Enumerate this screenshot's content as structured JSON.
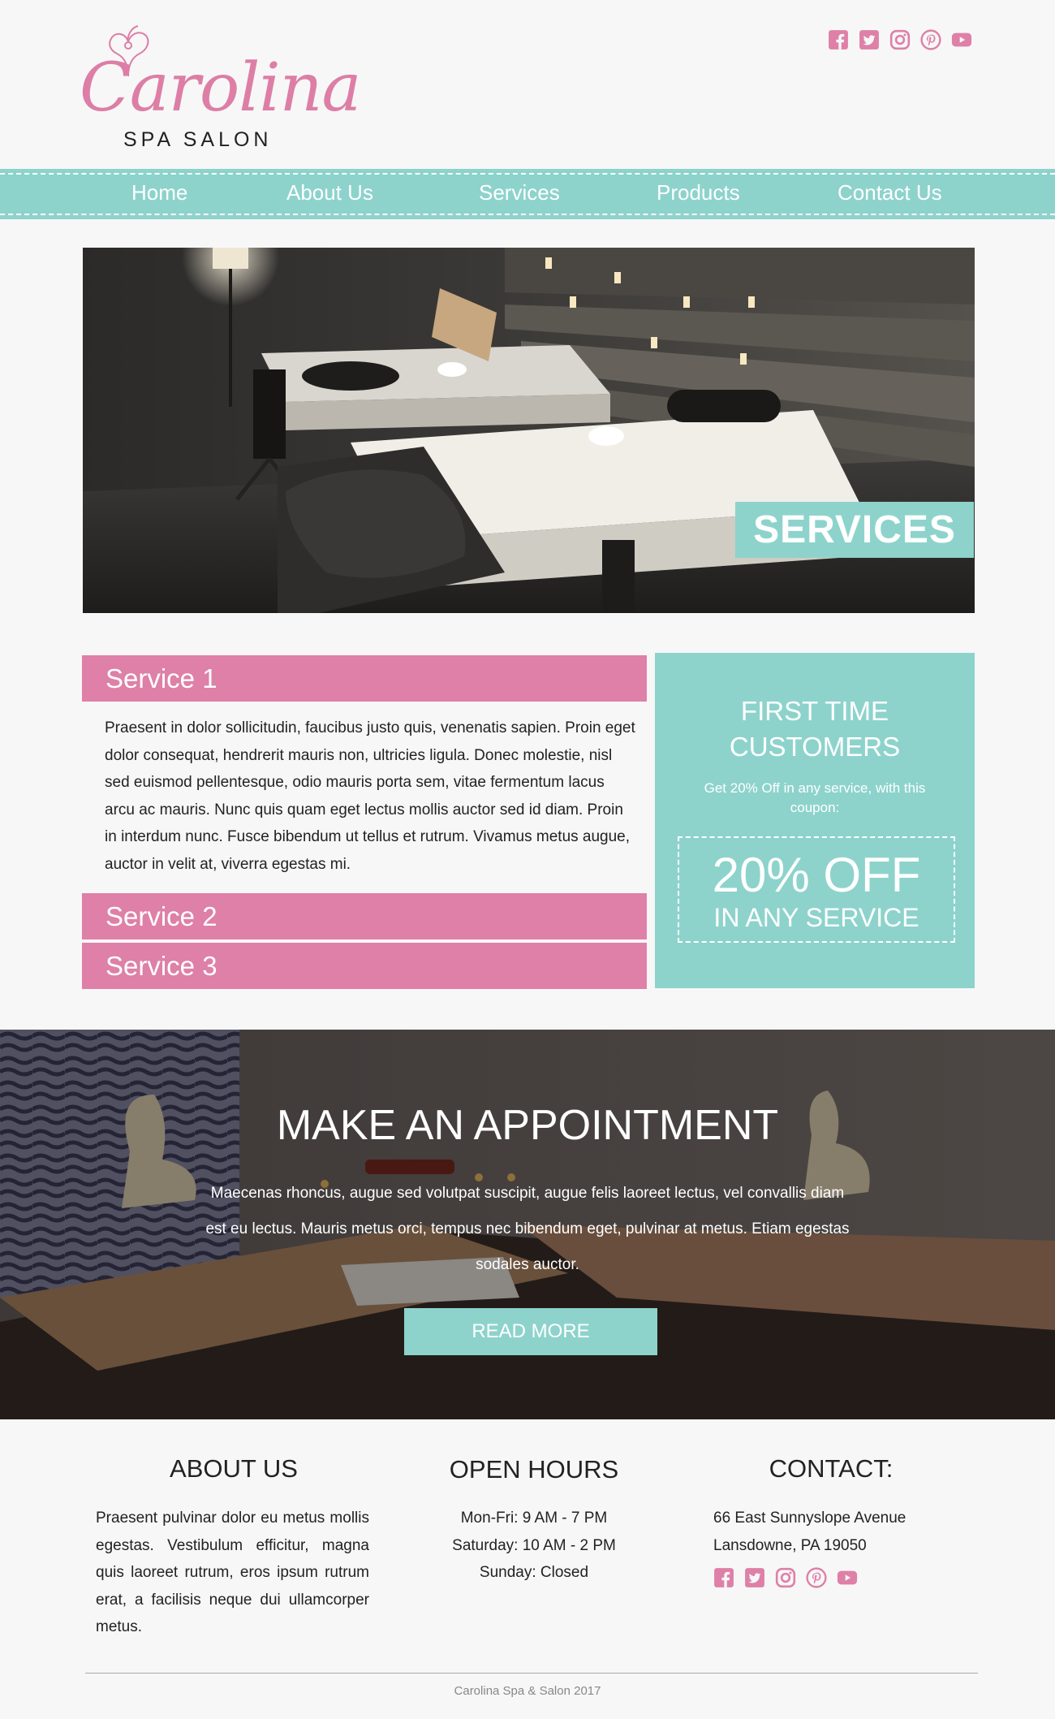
{
  "brand": {
    "logo_script": "Carolina",
    "logo_sub": "SPA SALON",
    "accent_pink": "#de80a7",
    "accent_teal": "#8dd3cc"
  },
  "social": [
    "facebook-icon",
    "twitter-icon",
    "instagram-icon",
    "pinterest-icon",
    "youtube-icon"
  ],
  "nav": {
    "items": [
      {
        "label": "Home"
      },
      {
        "label": "About Us"
      },
      {
        "label": "Services"
      },
      {
        "label": "Products"
      },
      {
        "label": "Contact Us"
      }
    ]
  },
  "hero": {
    "tag": "SERVICES"
  },
  "services": {
    "items": [
      {
        "title": "Service 1",
        "body": "Praesent in dolor sollicitudin, faucibus justo quis, venenatis sapien. Proin eget dolor consequat, hendrerit mauris non, ultricies ligula. Donec molestie, nisl sed euismod pellentesque, odio mauris porta sem, vitae fermentum lacus arcu ac mauris. Nunc quis quam eget lectus mollis auctor sed id diam. Proin in interdum nunc. Fusce bibendum ut tellus et rutrum. Vivamus metus augue, auctor in velit at, viverra egestas mi."
      },
      {
        "title": "Service 2"
      },
      {
        "title": "Service 3"
      }
    ]
  },
  "coupon": {
    "title_line1": "FIRST TIME",
    "title_line2": "CUSTOMERS",
    "text": "Get 20% Off in any service, with this coupon:",
    "big": "20% OFF",
    "small": "IN ANY SERVICE"
  },
  "appointment": {
    "title": "MAKE AN APPOINTMENT",
    "text": "Maecenas rhoncus, augue sed volutpat suscipit, augue felis laoreet lectus, vel convallis diam est eu lectus. Mauris metus orci, tempus nec bibendum eget, pulvinar at metus. Etiam egestas sodales auctor.",
    "button": "READ MORE"
  },
  "footer": {
    "about": {
      "title": "ABOUT US",
      "text": "Praesent pulvinar dolor eu metus mollis egestas. Vestibulum efficitur, magna quis laoreet rutrum, eros ipsum rutrum erat, a facilisis neque dui ullamcorper metus."
    },
    "hours": {
      "title": "OPEN HOURS",
      "lines": [
        "Mon-Fri: 9 AM - 7 PM",
        "Saturday: 10 AM - 2 PM",
        "Sunday: Closed"
      ]
    },
    "contact": {
      "title": "CONTACT:",
      "lines": [
        "66 East Sunnyslope Avenue",
        "Lansdowne, PA 19050"
      ]
    },
    "copyright": "Carolina Spa & Salon 2017"
  }
}
